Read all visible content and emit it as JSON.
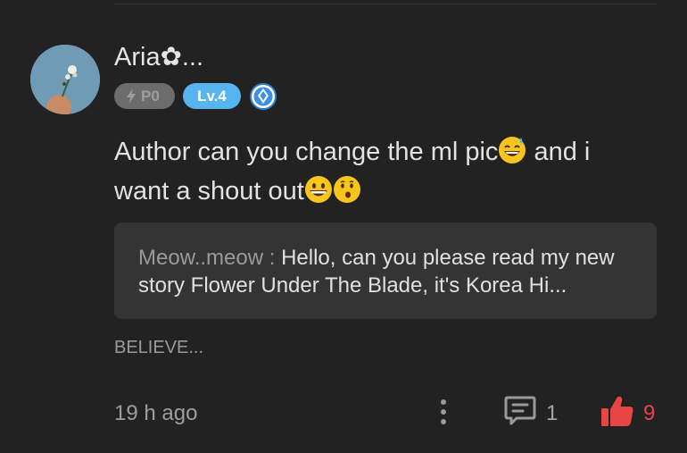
{
  "comment": {
    "username": "Aria✿...",
    "badges": {
      "power_label": "P0",
      "level_label": "Lv.4"
    },
    "text_part1": "Author can you change the ml pic",
    "text_part2": " and i want a shout out",
    "reply": {
      "author": "Meow..meow : ",
      "text": "Hello, can you please read my new story Flower Under The Blade, it's Korea Hi..."
    },
    "tag": "BELIEVE...",
    "time": "19 h ago",
    "reply_count": "1",
    "like_count": "9"
  },
  "colors": {
    "background": "#222222",
    "reply_box": "#343434",
    "level_badge": "#56b5ef",
    "power_badge": "#6c6c6c",
    "like": "#e84545"
  },
  "icons": [
    "avatar-image",
    "bolt-icon",
    "gem-icon",
    "sweat-smile-emoji",
    "grinning-emoji",
    "kissing-emoji",
    "more-vertical-icon",
    "comment-icon",
    "thumbs-up-icon"
  ]
}
